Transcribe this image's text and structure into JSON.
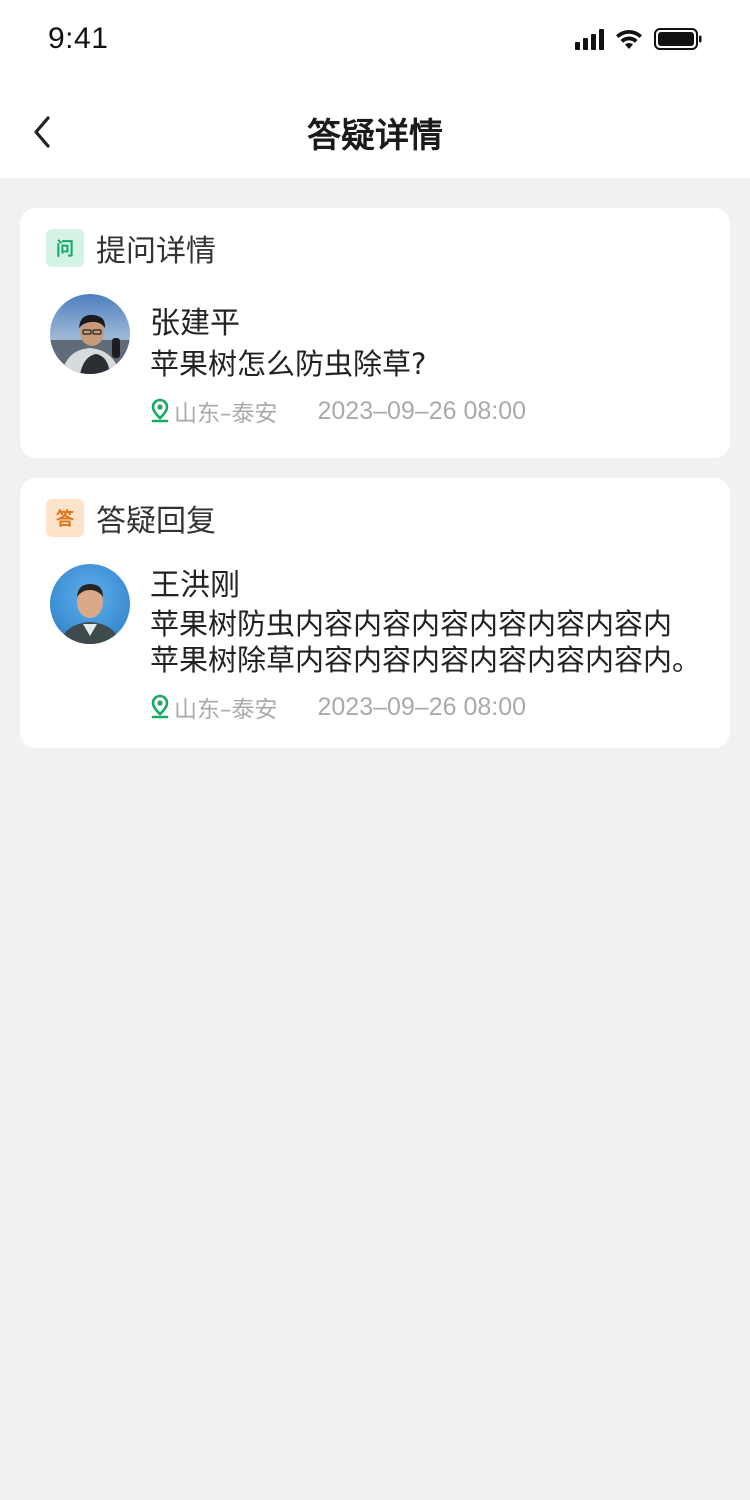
{
  "status_bar": {
    "time": "9:41"
  },
  "nav": {
    "title": "答疑详情"
  },
  "question": {
    "tag": "问",
    "section_title": "提问详情",
    "user_name": "张建平",
    "content": "苹果树怎么防虫除草?",
    "location": "山东–泰安",
    "time": "2023–09–26 08:00"
  },
  "answer": {
    "tag": "答",
    "section_title": "答疑回复",
    "user_name": "王洪刚",
    "content_line1": "苹果树防虫内容内容内容内容内容内容内",
    "content_line2": "苹果树除草内容内容内容内容内容内容内。",
    "location": "山东–泰安",
    "time": "2023–09–26 08:00"
  },
  "colors": {
    "accent_green": "#17a86a",
    "accent_orange": "#e07418",
    "background": "#f1f1f1"
  },
  "icons": [
    "signal-icon",
    "wifi-icon",
    "battery-icon",
    "back-icon",
    "location-pin-icon"
  ]
}
